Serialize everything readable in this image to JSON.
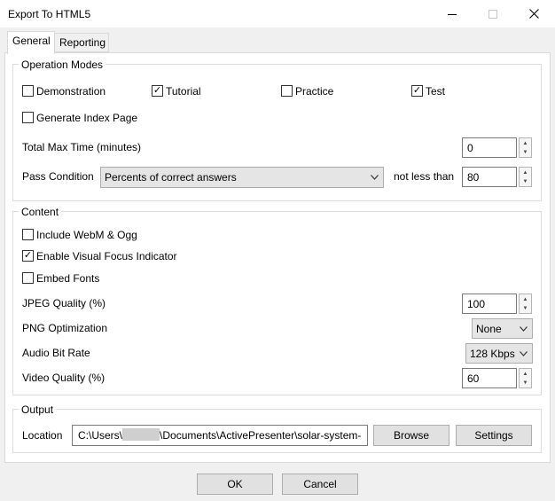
{
  "window": {
    "title": "Export To HTML5"
  },
  "tabs": [
    {
      "label": "General"
    },
    {
      "label": "Reporting"
    }
  ],
  "operation_modes": {
    "title": "Operation Modes",
    "demonstration": {
      "label": "Demonstration",
      "checked": false
    },
    "tutorial": {
      "label": "Tutorial",
      "checked": true
    },
    "practice": {
      "label": "Practice",
      "checked": false
    },
    "test": {
      "label": "Test",
      "checked": true
    },
    "generate_index": {
      "label": "Generate Index Page",
      "checked": false
    },
    "total_max_time_label": "Total Max Time (minutes)",
    "total_max_time_value": "0",
    "pass_condition_label": "Pass Condition",
    "pass_condition_value": "Percents of correct answers",
    "not_less_than_label": "not less than",
    "not_less_than_value": "80"
  },
  "content": {
    "title": "Content",
    "include_webm": {
      "label": "Include WebM & Ogg",
      "checked": false
    },
    "visual_focus": {
      "label": "Enable Visual Focus Indicator",
      "checked": true
    },
    "embed_fonts": {
      "label": "Embed Fonts",
      "checked": false
    },
    "jpeg_quality_label": "JPEG Quality (%)",
    "jpeg_quality_value": "100",
    "png_optimization_label": "PNG Optimization",
    "png_optimization_value": "None",
    "audio_bit_rate_label": "Audio Bit Rate",
    "audio_bit_rate_value": "128 Kbps",
    "video_quality_label": "Video Quality (%)",
    "video_quality_value": "60"
  },
  "output": {
    "title": "Output",
    "location_label": "Location",
    "location_prefix": "C:\\Users\\",
    "location_suffix": "\\Documents\\ActivePresenter\\solar-system-",
    "browse_label": "Browse",
    "settings_label": "Settings"
  },
  "footer": {
    "ok_label": "OK",
    "cancel_label": "Cancel"
  },
  "icons": {
    "minimize": "minimize-icon",
    "maximize": "maximize-icon",
    "close": "close-icon",
    "check": "checkmark-icon",
    "chevron": "chevron-down-icon"
  }
}
